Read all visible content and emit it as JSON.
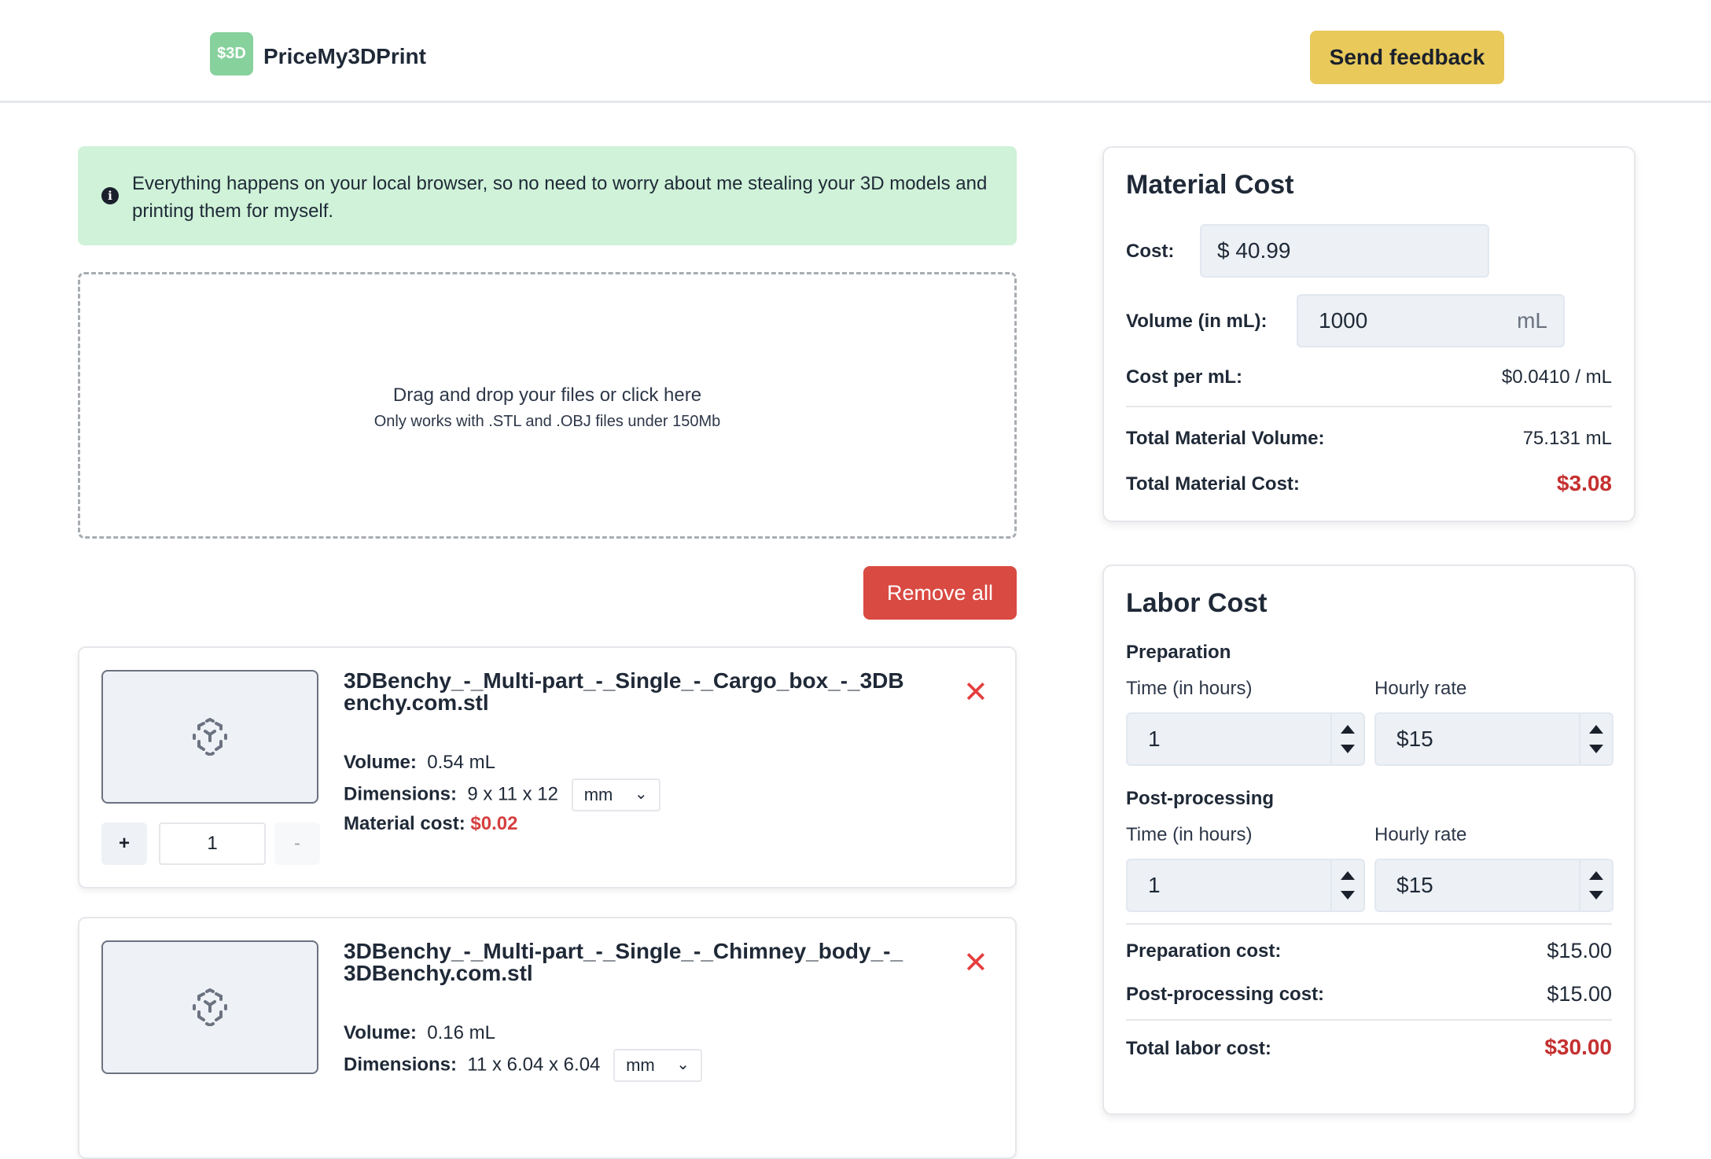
{
  "header": {
    "logo_text": "$3D",
    "brand": "PriceMy3DPrint",
    "feedback_label": "Send feedback"
  },
  "notice": {
    "text": "Everything happens on your local browser, so no need to worry about me stealing your 3D models and printing them for myself."
  },
  "dropzone": {
    "main": "Drag and drop your files or click here",
    "sub": "Only works with .STL and .OBJ files under 150Mb"
  },
  "remove_all_label": "Remove all",
  "files": [
    {
      "name": "3DBenchy_-_Multi-part_-_Single_-_Cargo_box_-_3DBenchy.com.stl",
      "volume_label": "Volume:",
      "volume": "0.54 mL",
      "dimensions_label": "Dimensions:",
      "dimensions": "9 x 11 x 12",
      "unit": "mm",
      "material_cost_label": "Material cost:",
      "material_cost": "$0.02",
      "quantity": "1"
    },
    {
      "name": "3DBenchy_-_Multi-part_-_Single_-_Chimney_body_-_3DBenchy.com.stl",
      "volume_label": "Volume:",
      "volume": "0.16 mL",
      "dimensions_label": "Dimensions:",
      "dimensions": "11 x 6.04 x 6.04",
      "unit": "mm"
    }
  ],
  "quantity_controls": {
    "plus": "+",
    "minus": "-"
  },
  "material": {
    "title": "Material Cost",
    "cost_label": "Cost:",
    "cost_prefix": "$",
    "cost_value": "40.99",
    "volume_label": "Volume (in mL):",
    "volume_value": "1000",
    "volume_unit": "mL",
    "cost_per_ml_label": "Cost per mL:",
    "cost_per_ml": "$0.0410 / mL",
    "total_volume_label": "Total Material Volume:",
    "total_volume": "75.131 mL",
    "total_cost_label": "Total Material Cost:",
    "total_cost": "$3.08"
  },
  "labor": {
    "title": "Labor Cost",
    "preparation_label": "Preparation",
    "postprocessing_label": "Post-processing",
    "time_label": "Time (in hours)",
    "rate_label": "Hourly rate",
    "prep_time": "1",
    "prep_rate": "$15",
    "post_time": "1",
    "post_rate": "$15",
    "prep_cost_label": "Preparation cost:",
    "prep_cost": "$15.00",
    "post_cost_label": "Post-processing cost:",
    "post_cost": "$15.00",
    "total_label": "Total labor cost:",
    "total": "$30.00"
  },
  "icons": {
    "info": "info-icon",
    "close": "close-icon",
    "model_placeholder": "cube-icon",
    "chevron": "chevron-down-icon",
    "spinner_up": "spinner-up-icon",
    "spinner_down": "spinner-down-icon"
  },
  "colors": {
    "accent_green": "#86d19c",
    "notice_bg": "#cff2d8",
    "feedback_bg": "#e8c95a",
    "danger": "#d94a42",
    "cost_red": "#c53030"
  }
}
